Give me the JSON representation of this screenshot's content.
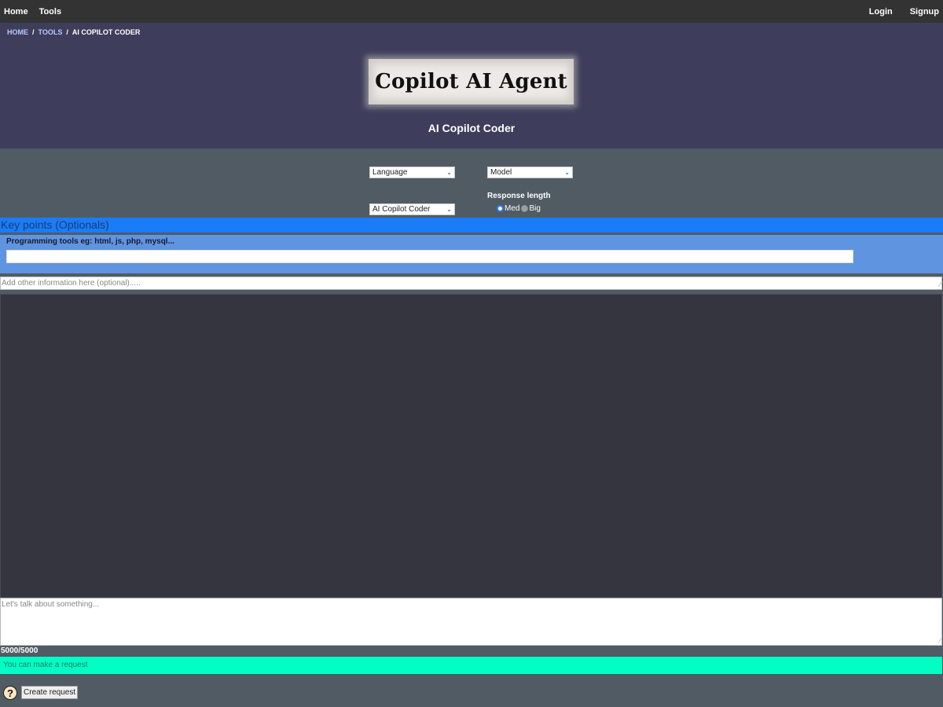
{
  "nav": {
    "left": [
      "Home",
      "Tools"
    ],
    "right": [
      "Login",
      "Signup"
    ]
  },
  "breadcrumb": {
    "items": [
      "HOME",
      "TOOLS"
    ],
    "current": "AI COPILOT CODER",
    "separator": "/"
  },
  "logo": {
    "text": "Copilot AI Agent"
  },
  "page": {
    "title": "AI Copilot Coder"
  },
  "form": {
    "language_select": "Language",
    "model_select": "Model",
    "tool_select": "AI Copilot Coder",
    "response_length_label": "Response length",
    "response_options": [
      "Med",
      "Big"
    ],
    "response_selected": "Med"
  },
  "keypoints": {
    "header": "Key points (Optionals)",
    "programming_tools_label": "Programming tools eg: html, js, php, mysql..."
  },
  "other_info": {
    "placeholder": "Add other information here (optional)....."
  },
  "chat": {
    "placeholder": "Let's talk about something..."
  },
  "counter": "5000/5000",
  "status": "You can make a request",
  "actions": {
    "help_icon": "?",
    "create_label": "Create request"
  },
  "colors": {
    "nav_bg": "#333333",
    "hero_bg": "#3e3e5c",
    "page_bg": "#515b63",
    "keypoints_bg": "#1a7cf7",
    "tools_panel_bg": "#5f95e0",
    "output_bg": "#35353f",
    "status_bg": "#00ffc5"
  }
}
